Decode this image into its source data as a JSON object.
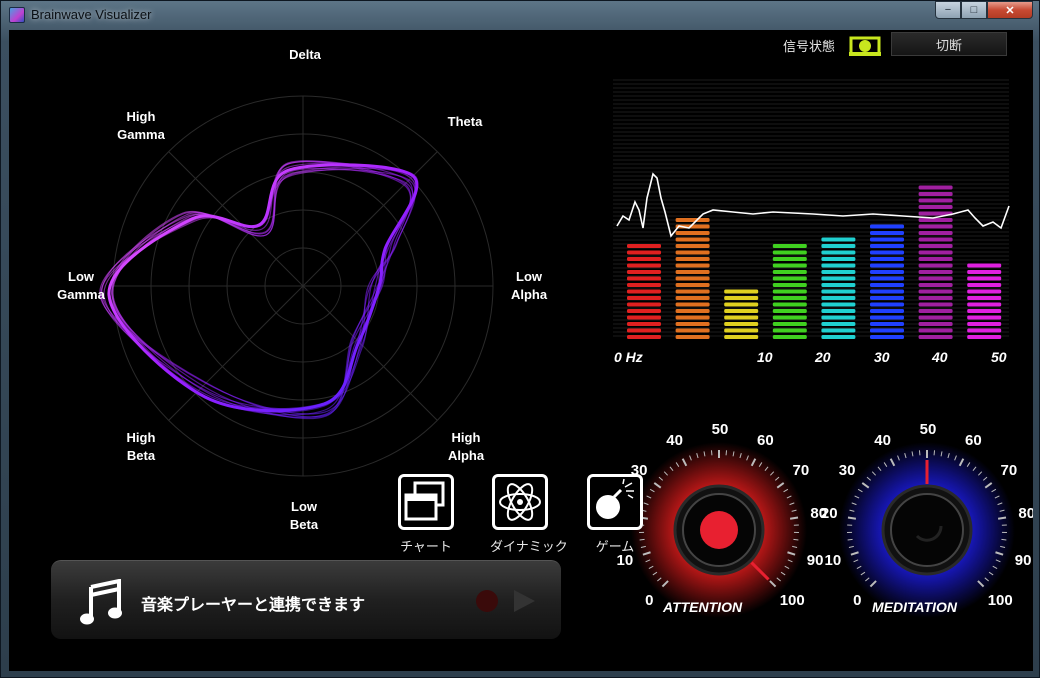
{
  "window": {
    "title": "Brainwave Visualizer",
    "controls": {
      "minimize": "−",
      "maximize": "□",
      "close": "✕"
    }
  },
  "signal": {
    "label": "信号状態",
    "icon": "signal-icon",
    "disconnect_label": "切断",
    "color": "#c8e61e"
  },
  "radar": {
    "labels": {
      "delta": "Delta",
      "theta": "Theta",
      "low_alpha": [
        "Low",
        "Alpha"
      ],
      "high_alpha": [
        "High",
        "Alpha"
      ],
      "low_beta": [
        "Low",
        "Beta"
      ],
      "high_beta": [
        "High",
        "Beta"
      ],
      "low_gamma": [
        "Low",
        "Gamma"
      ],
      "high_gamma": [
        "High",
        "Gamma"
      ]
    },
    "rings": 5,
    "trace_color": "#c840ff"
  },
  "spectrum": {
    "x_labels": [
      "0 Hz",
      "10",
      "20",
      "30",
      "40",
      "50"
    ],
    "bars": [
      {
        "color": "#e02020",
        "level": 0.55
      },
      {
        "color": "#e07020",
        "level": 0.71
      },
      {
        "color": "#e0d020",
        "level": 0.32
      },
      {
        "color": "#40d020",
        "level": 0.55
      },
      {
        "color": "#20d0d0",
        "level": 0.59
      },
      {
        "color": "#2040ff",
        "level": 0.69
      },
      {
        "color": "#a020a0",
        "level": 0.91
      },
      {
        "color": "#e020e0",
        "level": 0.47
      }
    ]
  },
  "nav": [
    {
      "label": "チャート",
      "icon": "chart-windows-icon"
    },
    {
      "label": "ダイナミック",
      "icon": "atom-icon"
    },
    {
      "label": "ゲーム",
      "icon": "bomb-icon"
    }
  ],
  "player": {
    "text": "音楽プレーヤーと連携できます",
    "note_icon": "music-note-icon",
    "record_icon": "record-icon",
    "play_icon": "play-icon"
  },
  "gauges": [
    {
      "title": "ATTENTION",
      "ticks": [
        "0",
        "10",
        "20",
        "30",
        "40",
        "50",
        "60",
        "70",
        "80",
        "90",
        "100"
      ],
      "value": 100,
      "glow": "#ff2020"
    },
    {
      "title": "MEDITATION",
      "ticks": [
        "0",
        "10",
        "20",
        "30",
        "40",
        "50",
        "60",
        "70",
        "80",
        "90",
        "100"
      ],
      "value": 50,
      "glow": "#2020ff"
    }
  ]
}
